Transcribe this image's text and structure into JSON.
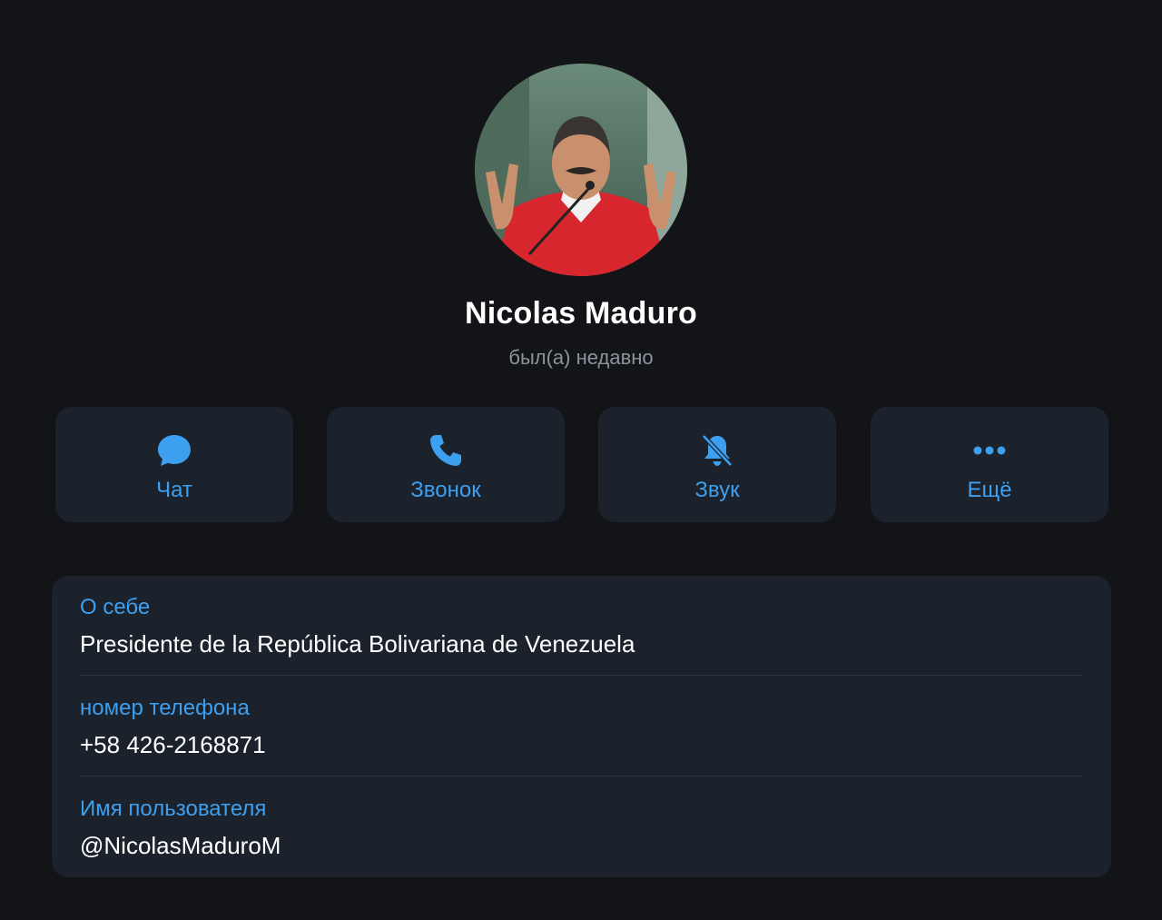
{
  "profile": {
    "name": "Nicolas Maduro",
    "status": "был(а) недавно"
  },
  "actions": [
    {
      "label": "Чат",
      "icon": "chat-bubble-icon"
    },
    {
      "label": "Звонок",
      "icon": "phone-icon"
    },
    {
      "label": "Звук",
      "icon": "bell-muted-icon"
    },
    {
      "label": "Ещё",
      "icon": "more-dots-icon"
    }
  ],
  "info": {
    "bio": {
      "key": "О себе",
      "value": "Presidente de la República Bolivariana de Venezuela"
    },
    "phone": {
      "key": "номер телефона",
      "value": "+58 426-2168871"
    },
    "username": {
      "key": "Имя пользователя",
      "value": "@NicolasMaduroM"
    }
  },
  "colors": {
    "background": "#131417",
    "card": "#1b222c",
    "accent": "#3d9ff0"
  }
}
